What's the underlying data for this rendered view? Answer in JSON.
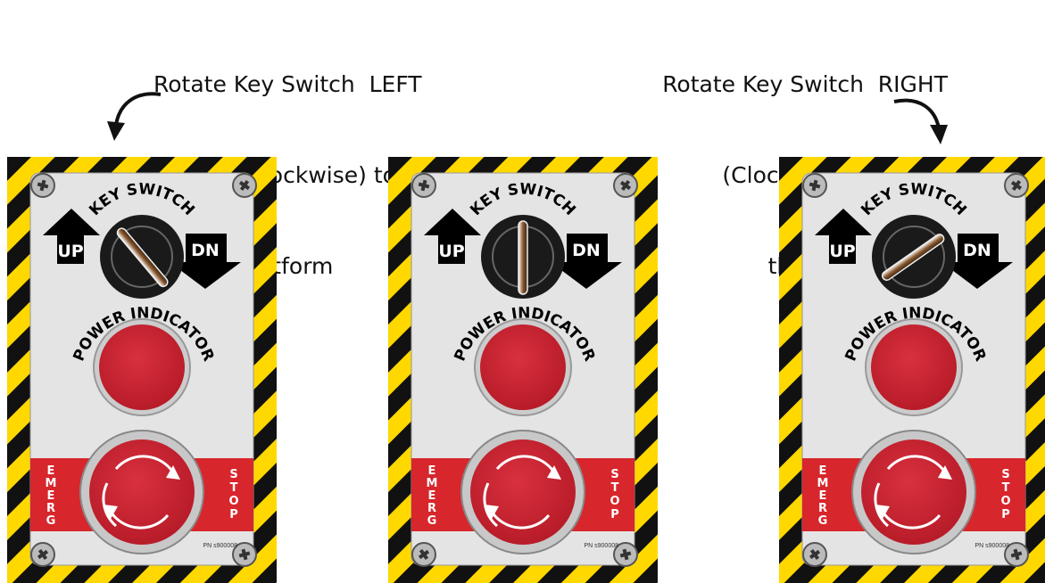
{
  "captions": {
    "left": [
      "Rotate Key Switch  LEFT",
      "(Counterclockwise) to raise",
      "the Lift Platform"
    ],
    "right": [
      "Rotate Key Switch  RIGHT",
      "(Clockwise) to lower",
      "the Lift Platform"
    ]
  },
  "panel_text": {
    "key_switch": "KEY SWITCH",
    "power_indicator": "POWER INDICATOR",
    "up": "UP",
    "dn": "DN",
    "emerg": [
      "E",
      "M",
      "E",
      "R",
      "G"
    ],
    "stop": [
      "S",
      "T",
      "O",
      "P"
    ],
    "part_number": "PN s900008"
  },
  "panels": [
    {
      "id": "left",
      "key_position": "left",
      "key_angle_deg": -40
    },
    {
      "id": "center",
      "key_position": "center",
      "key_angle_deg": 0
    },
    {
      "id": "right",
      "key_position": "right",
      "key_angle_deg": 55
    }
  ],
  "colors": {
    "hazard_yellow": "#ffd800",
    "hazard_black": "#111111",
    "plate": "#e4e4e4",
    "indicator_red": "#d0202f",
    "stop_band": "#d7262c",
    "key_black": "#1a1a1a"
  }
}
